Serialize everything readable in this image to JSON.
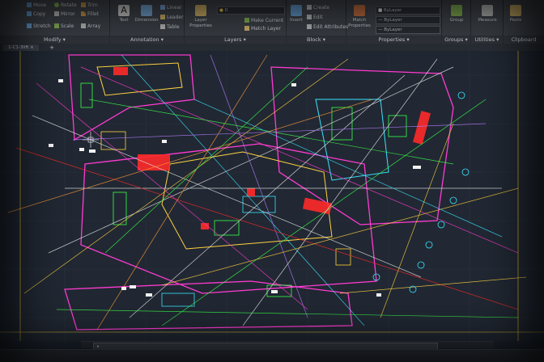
{
  "ribbon": {
    "modify": {
      "title": "Modify",
      "buttons": [
        "Move",
        "Rotate",
        "Trim",
        "Copy",
        "Mirror",
        "Fillet",
        "Stretch",
        "Scale",
        "Array"
      ]
    },
    "annotation": {
      "title": "Annotation",
      "text": "Text",
      "dimension": "Dimension",
      "linear": "Linear",
      "leader": "Leader",
      "table": "Table"
    },
    "layers": {
      "title": "Layers",
      "properties": "Layer Properties",
      "make_current": "Make Current",
      "match_layer": "Match Layer",
      "current_layer": "0"
    },
    "block": {
      "title": "Block",
      "insert": "Insert",
      "create": "Create",
      "edit": "Edit",
      "edit_attributes": "Edit Attributes"
    },
    "properties": {
      "title": "Properties",
      "match": "Match Properties",
      "color": "ByLayer",
      "linetype": "ByLayer",
      "lineweight": "ByLayer"
    },
    "groups": {
      "title": "Groups",
      "group": "Group"
    },
    "utilities": {
      "title": "Utilities",
      "measure": "Measure"
    },
    "clipboard": {
      "title": "Clipboard",
      "paste": "Paste"
    }
  },
  "tabs": {
    "document": "1-C1-3lift",
    "new": "+"
  },
  "colors": {
    "canvas_bg": "#212833",
    "ribbon_bg": "#3f434a",
    "line_colors": [
      "#e8e8e8",
      "#ff3bd2",
      "#ffd23f",
      "#39ff49",
      "#3ae3ff",
      "#ff2a2a",
      "#b67bff",
      "#ff9b3b"
    ]
  },
  "icons": {
    "move": "move-icon",
    "rotate": "rotate-icon",
    "trim": "trim-icon",
    "copy": "copy-icon",
    "mirror": "mirror-icon",
    "fillet": "fillet-icon",
    "stretch": "stretch-icon",
    "scale": "scale-icon",
    "array": "array-icon",
    "text": "text-icon",
    "dimension": "dimension-icon",
    "layers": "layer-stack-icon",
    "insert": "insert-block-icon",
    "match": "match-properties-icon",
    "group": "group-icon",
    "measure": "ruler-icon",
    "paste": "clipboard-icon"
  }
}
